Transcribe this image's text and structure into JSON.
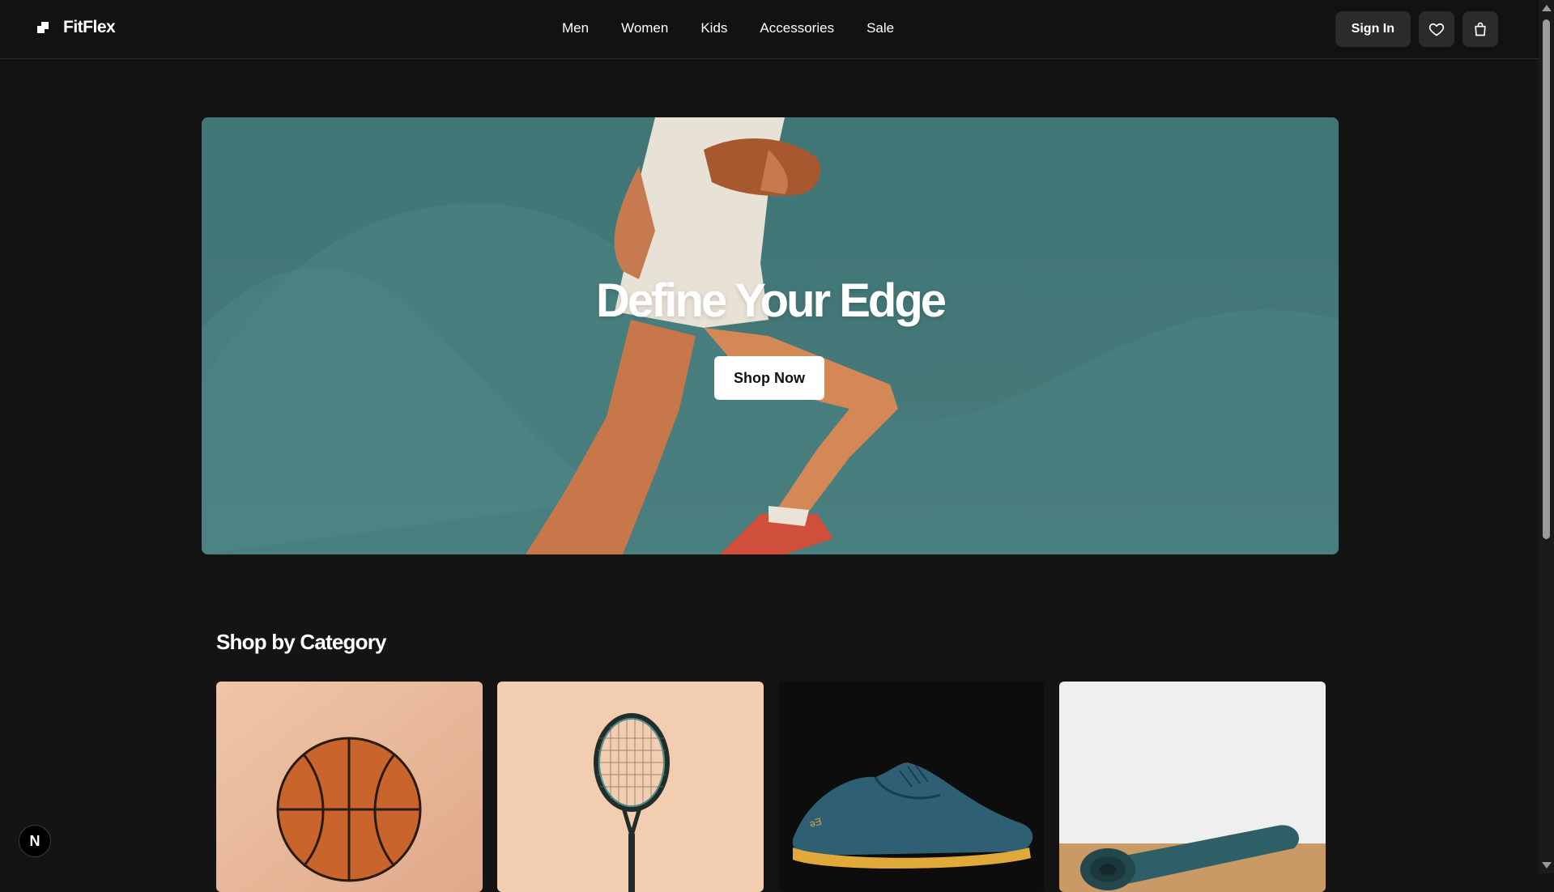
{
  "brand": {
    "name": "FitFlex"
  },
  "nav": {
    "items": [
      {
        "label": "Men"
      },
      {
        "label": "Women"
      },
      {
        "label": "Kids"
      },
      {
        "label": "Accessories"
      },
      {
        "label": "Sale"
      }
    ]
  },
  "header": {
    "signin_label": "Sign In",
    "wishlist_icon": "heart-icon",
    "cart_icon": "shopping-bag-icon"
  },
  "hero": {
    "title": "Define Your Edge",
    "cta_label": "Shop Now"
  },
  "categories": {
    "title": "Shop by Category",
    "items": [
      {
        "image": "basketball"
      },
      {
        "image": "tennis-racket"
      },
      {
        "image": "running-shoe"
      },
      {
        "image": "yoga-mat"
      }
    ]
  },
  "dev_badge": {
    "label": "N"
  },
  "colors": {
    "background": "#141414",
    "hero": "#417575",
    "button": "#2b2b2b"
  }
}
